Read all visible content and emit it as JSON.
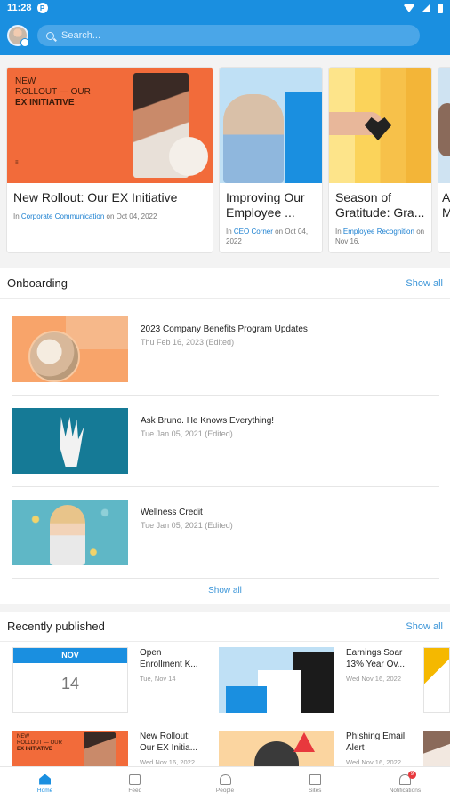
{
  "status_bar": {
    "time": "11:28",
    "app_badge": "P"
  },
  "header": {
    "search_placeholder": "Search..."
  },
  "featured": [
    {
      "title": "New Rollout: Our EX Initiative",
      "prefix": "In",
      "category": "Corporate Communication",
      "date_text": "on Oct 04, 2022",
      "image_text_1": "NEW",
      "image_text_2": "ROLLOUT — OUR",
      "image_text_3": "EX INITIATIVE"
    },
    {
      "title": "Improving Our Employee ...",
      "prefix": "In",
      "category": "CEO Corner",
      "date_text": "on Oct 04, 2022"
    },
    {
      "title": "Season of Gratitude: Gra...",
      "prefix": "In",
      "category": "Employee Recognition",
      "date_text": "on Nov 16,"
    },
    {
      "title": "A M"
    }
  ],
  "onboarding": {
    "title": "Onboarding",
    "show_all": "Show all",
    "items": [
      {
        "title": "2023 Company Benefits Program Updates",
        "date": "Thu Feb 16, 2023 (Edited)"
      },
      {
        "title": "Ask Bruno. He Knows Everything!",
        "date": "Tue Jan 05, 2021 (Edited)"
      },
      {
        "title": "Wellness Credit",
        "date": "Tue Jan 05, 2021 (Edited)"
      }
    ],
    "show_all_bottom": "Show all"
  },
  "recent": {
    "title": "Recently published",
    "show_all": "Show all",
    "items": [
      {
        "title": "Open Enrollment K...",
        "date": "Tue, Nov 14",
        "cal_month": "NOV",
        "cal_day": "14"
      },
      {
        "title": "Earnings Soar 13% Year Ov...",
        "date": "Wed Nov 16, 2022"
      },
      {
        "title": "New Rollout: Our EX Initia...",
        "date": "Wed Nov 16, 2022",
        "image_text_1": "NEW",
        "image_text_2": "ROLLOUT — OUR",
        "image_text_3": "EX INITIATIVE"
      },
      {
        "title": "Phishing Email Alert",
        "date": "Wed Nov 16, 2022"
      }
    ]
  },
  "bottom_nav": [
    {
      "label": "Home",
      "icon": "home-icon"
    },
    {
      "label": "Feed",
      "icon": "feed-icon"
    },
    {
      "label": "People",
      "icon": "people-icon"
    },
    {
      "label": "Sites",
      "icon": "sites-icon"
    },
    {
      "label": "Notifications",
      "icon": "bell-icon",
      "badge": "9"
    }
  ],
  "colors": {
    "brand": "#1a8fe0",
    "link": "#3b95d8",
    "orange": "#f26b3a"
  }
}
